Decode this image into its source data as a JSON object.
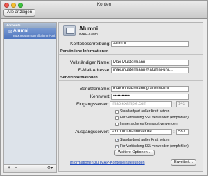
{
  "window": {
    "title": "Konten",
    "show_all_label": "Alle anzeigen"
  },
  "sidebar": {
    "header": "Accounts",
    "accounts": [
      {
        "name": "Alumni",
        "email": "max.mustermann@alumni-uni…"
      }
    ],
    "add_symbol": "+",
    "remove_symbol": "−",
    "gear_symbol": "⚙▾"
  },
  "account_header": {
    "title": "Alumni",
    "subtitle": "IMAP-Konto"
  },
  "form": {
    "description_label": "Kontobeschreibung:",
    "description_value": "Alumni",
    "personal_section": "Persönliche Informationen",
    "name_label": "Vollständiger Name:",
    "name_value": "Max Mustermann",
    "email_label": "E-Mail-Adresse:",
    "email_value": "max.mustermann@alumni-uni…",
    "server_section": "Serverinformationen",
    "username_label": "Benutzername:",
    "username_value": "max.mustermann@alumni-uni…",
    "password_label": "Kennwort:",
    "password_value": "••••••••••••",
    "incoming_label": "Eingangsserver:",
    "incoming_placeholder": "imap.example.com",
    "incoming_port": "143",
    "incoming_checks": [
      {
        "label": "Standardport außer Kraft setzen",
        "checked": false
      },
      {
        "label": "Für Verbindung SSL verwenden (empfohlen)",
        "checked": false
      },
      {
        "label": "Immer sicheres Kennwort verwenden",
        "checked": false
      }
    ],
    "outgoing_label": "Ausgangsserver:",
    "outgoing_value": "smtp.uni-hannover.de",
    "outgoing_port": "587",
    "outgoing_checks": [
      {
        "label": "Standardport außer Kraft setzen",
        "checked": true
      },
      {
        "label": "Für Verbindung SSL verwenden (empfohlen)",
        "checked": true
      }
    ],
    "more_options_label": "Weitere Optionen…"
  },
  "footer": {
    "help_link": "Informationen zu IMAP-Konteneinstellungen",
    "advanced_label": "Erweitert…"
  }
}
